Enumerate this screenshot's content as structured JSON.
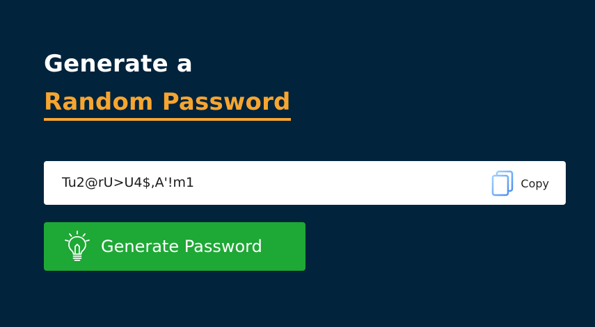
{
  "heading": {
    "line1": "Generate a",
    "line2": "Random Password"
  },
  "password": {
    "value": "Tu2@rU>U4$,A'!m1"
  },
  "copy_button": {
    "label": "Copy",
    "icon": "copy-icon"
  },
  "generate_button": {
    "label": "Generate Password",
    "icon": "lightbulb-icon"
  },
  "colors": {
    "background": "#01233c",
    "accent": "#f6a530",
    "button": "#1ea835",
    "copy_icon": "#5aa9f5"
  }
}
